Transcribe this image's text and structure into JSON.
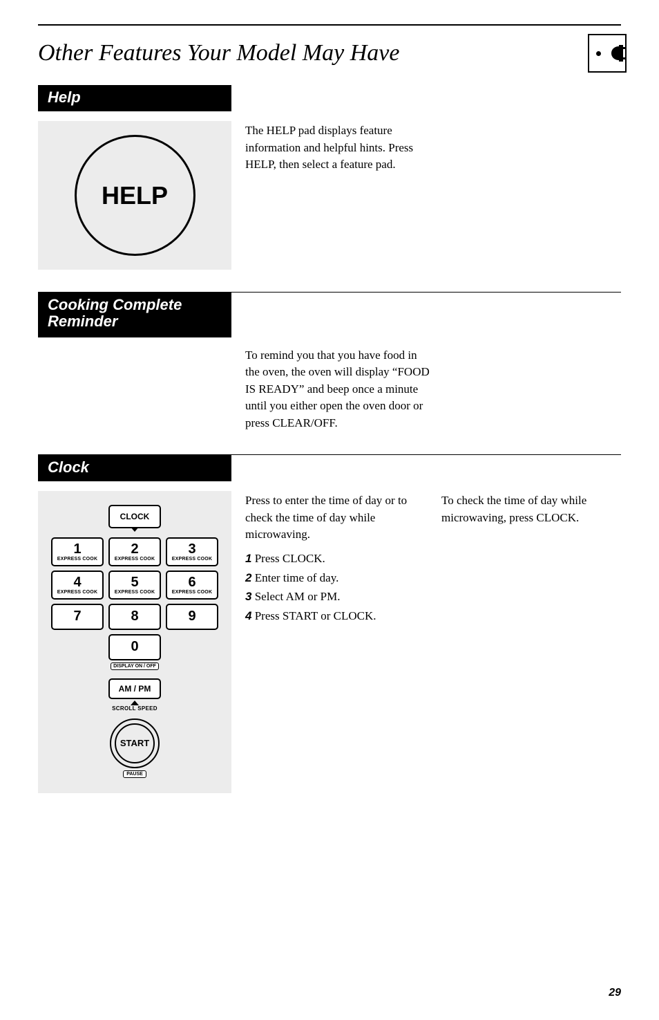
{
  "page_title": "Other Features Your Model May Have",
  "sections": {
    "help": {
      "header": "Help",
      "button_label": "HELP",
      "body": "The HELP pad displays feature information and helpful hints. Press HELP, then select a feature pad."
    },
    "reminder": {
      "header": "Cooking Complete Reminder",
      "body": "To remind you that you have food in the oven, the oven will display “FOOD IS READY” and beep once a minute until you either open the oven door or press CLEAR/OFF."
    },
    "clock": {
      "header": "Clock",
      "intro": "Press to enter the time of day or to check the time of day while microwaving.",
      "steps": [
        {
          "n": "1",
          "t": "Press CLOCK."
        },
        {
          "n": "2",
          "t": "Enter time of day."
        },
        {
          "n": "3",
          "t": "Select AM or PM."
        },
        {
          "n": "4",
          "t": "Press START or CLOCK."
        }
      ],
      "right": "To check the time of day while microwaving, press CLOCK."
    }
  },
  "keypad": {
    "clock": "CLOCK",
    "keys_express": [
      "1",
      "2",
      "3",
      "4",
      "5",
      "6"
    ],
    "express_label": "EXPRESS COOK",
    "keys_plain": [
      "7",
      "8",
      "9"
    ],
    "zero": "0",
    "display_label": "DISPLAY ON / OFF",
    "ampm": "AM / PM",
    "scroll": "SCROLL SPEED",
    "start": "START",
    "pause": "PAUSE"
  },
  "page_number": "29"
}
